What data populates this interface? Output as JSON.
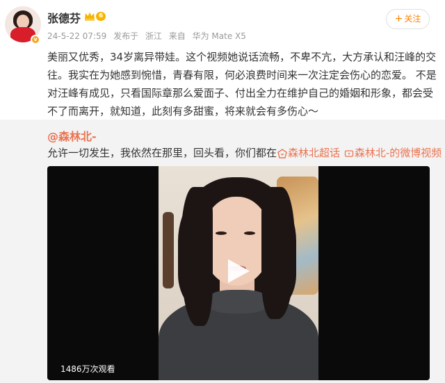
{
  "post": {
    "author": "张德芬",
    "level": "6",
    "date": "24-5-22 07:59",
    "publish_label": "发布于",
    "location": "浙江",
    "source_prefix": "来自",
    "device": "华为 Mate X5",
    "follow_label": "关注",
    "follow_symbol": "+",
    "text": "美丽又优秀，34岁离异带娃。这个视频她说话流畅，不卑不亢，大方承认和汪峰的交往。我实在为她感到惋惜，青春有限，何必浪费时间来一次注定会伤心的恋爱。 不是对汪峰有成见，只看国际章那么爱面子、付出全力在维护自己的婚姻和形象，都会受不了而离开，就知道，此刻有多甜蜜，将来就会有多伤心～",
    "verified_badge": "v"
  },
  "repost": {
    "author": "@森林北-",
    "text_prefix": "允许一切发生，我依然在那里，回头看，你们都在",
    "topic_tag": "森林北超话",
    "video_link": "森林北-的微博视频"
  },
  "video": {
    "view_count": "1486万次观看"
  },
  "colors": {
    "accent": "#ff8200",
    "link": "#eb7350",
    "repost_bg": "#f3f3f3"
  },
  "icons": [
    "crown-icon",
    "topic-icon",
    "video-link-icon",
    "play-icon",
    "verified-icon"
  ]
}
